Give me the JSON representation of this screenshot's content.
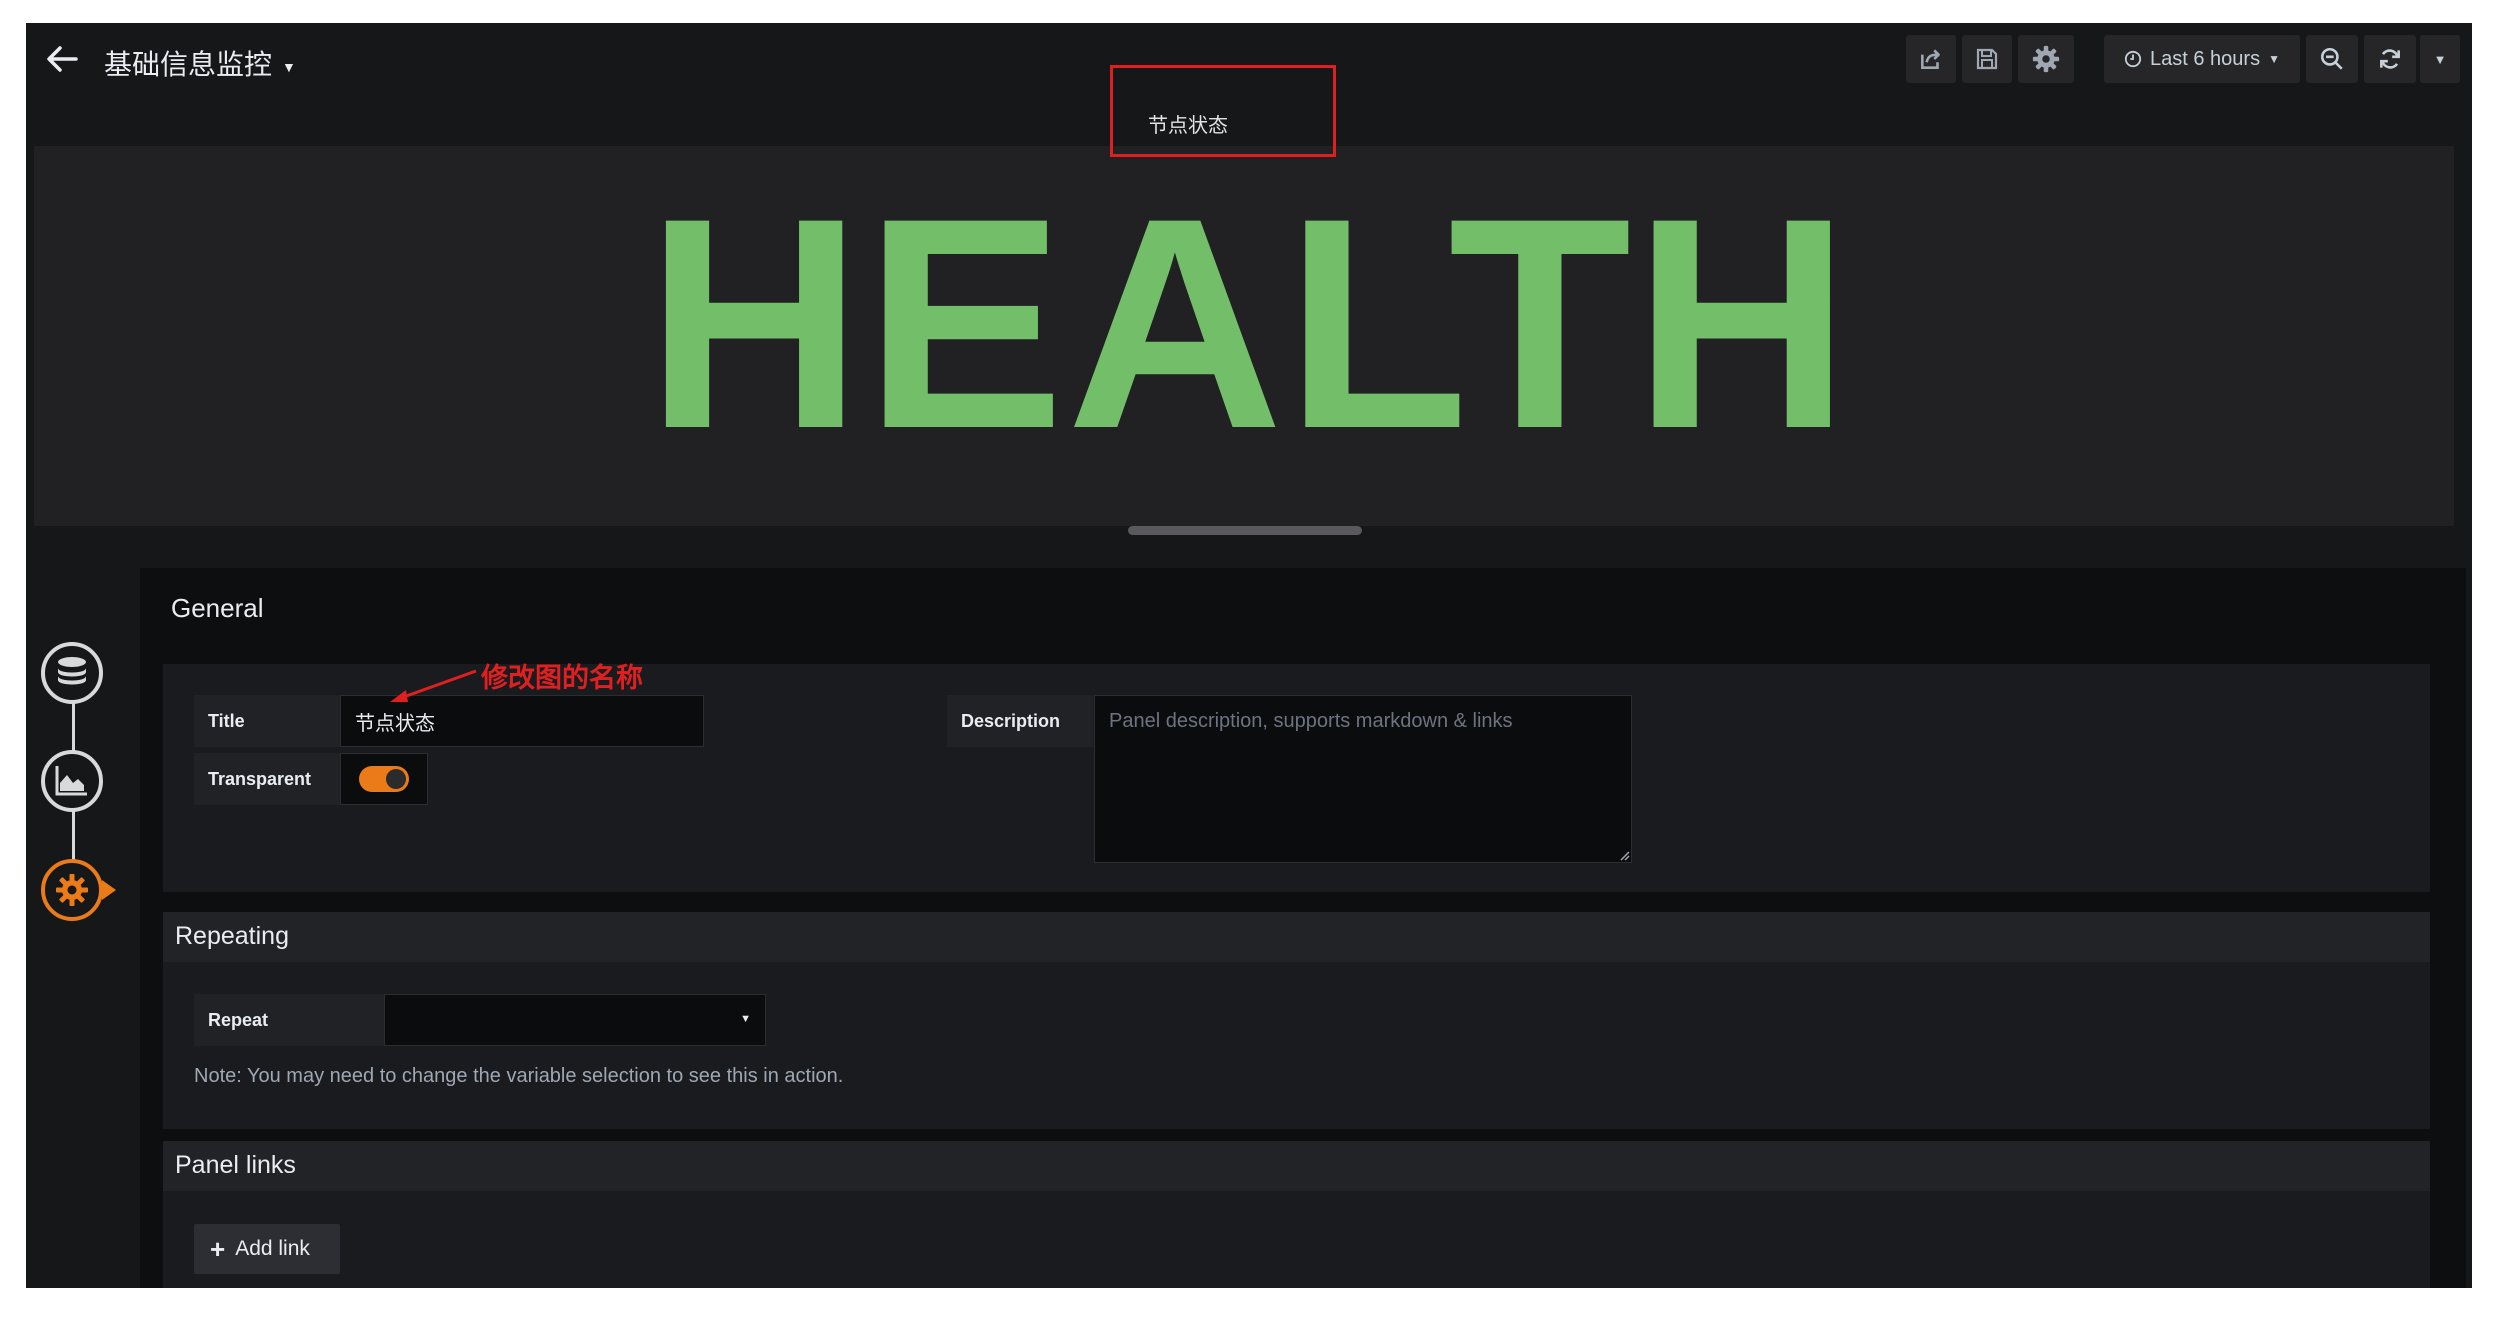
{
  "header": {
    "dashboard_title": "基础信息监控",
    "time_range": "Last 6 hours"
  },
  "panel": {
    "title": "节点状态",
    "value_text": "HEALTH",
    "value_color": "#73bf69"
  },
  "general": {
    "heading": "General",
    "title_label": "Title",
    "title_value": "节点状态",
    "transparent_label": "Transparent",
    "transparent_on": true,
    "description_label": "Description",
    "description_placeholder": "Panel description, supports markdown & links"
  },
  "repeating": {
    "heading": "Repeating",
    "repeat_label": "Repeat",
    "repeat_value": "",
    "note": "Note: You may need to change the variable selection to see this in action."
  },
  "panel_links": {
    "heading": "Panel links",
    "add_link_label": "Add link"
  },
  "annotation": {
    "text": "修改图的名称",
    "color": "#e02020"
  },
  "colors": {
    "accent": "#eb7b18",
    "background": "#161719"
  }
}
